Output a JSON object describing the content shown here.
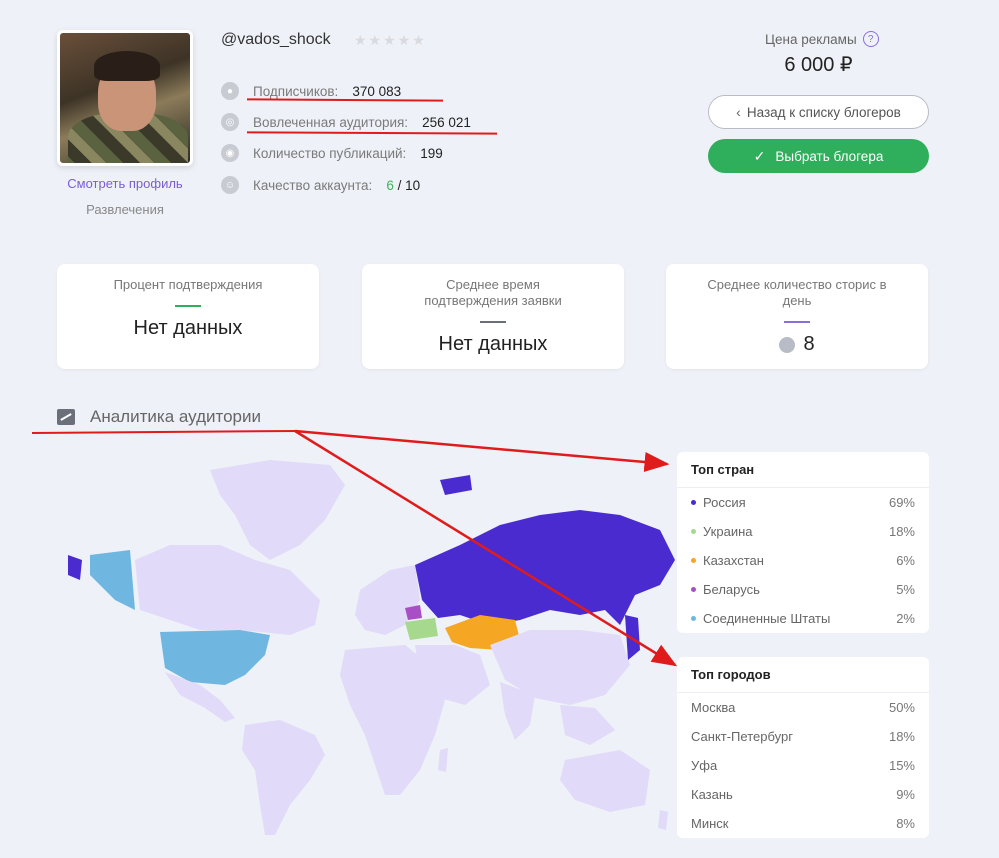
{
  "profile": {
    "username": "@vados_shock",
    "stars": "★★★★★",
    "view_profile": "Смотреть профиль",
    "category": "Развлечения",
    "stats": {
      "subscribers_label": "Подписчиков:",
      "subscribers_value": "370 083",
      "engaged_label": "Вовлеченная аудитория:",
      "engaged_value": "256 021",
      "posts_label": "Количество публикаций:",
      "posts_value": "199",
      "quality_label": "Качество аккаунта:",
      "quality_score": "6",
      "quality_max": "/ 10"
    }
  },
  "pricing": {
    "label": "Цена рекламы",
    "help": "?",
    "value": "6 000 ₽"
  },
  "buttons": {
    "back": "Назад к списку блогеров",
    "select": "Выбрать блогера"
  },
  "cards": [
    {
      "title": "Процент подтверждения",
      "value": "Нет данных",
      "accent": "#2fae5c"
    },
    {
      "title": "Среднее время подтверждения заявки",
      "value": "Нет данных",
      "accent": "#6b6f7a"
    },
    {
      "title": "Среднее количество сторис в день",
      "value": "8",
      "accent": "#8a6fd8"
    }
  ],
  "analytics": {
    "title": "Аналитика аудитории"
  },
  "top_countries": {
    "title": "Топ стран",
    "items": [
      {
        "name": "Россия",
        "pct": "69%",
        "color": "#4a2bd0"
      },
      {
        "name": "Украина",
        "pct": "18%",
        "color": "#a6d88e"
      },
      {
        "name": "Казахстан",
        "pct": "6%",
        "color": "#f5a623"
      },
      {
        "name": "Беларусь",
        "pct": "5%",
        "color": "#a94fc6"
      },
      {
        "name": "Соединенные Штаты",
        "pct": "2%",
        "color": "#6fb7e0"
      }
    ]
  },
  "top_cities": {
    "title": "Топ городов",
    "items": [
      {
        "name": "Москва",
        "pct": "50%"
      },
      {
        "name": "Санкт-Петербург",
        "pct": "18%"
      },
      {
        "name": "Уфа",
        "pct": "15%"
      },
      {
        "name": "Казань",
        "pct": "9%"
      },
      {
        "name": "Минск",
        "pct": "8%"
      }
    ]
  },
  "colors": {
    "map_land": "#e1daf8",
    "annotation": "#e01b1b",
    "primary_green": "#2fae5c",
    "accent_purple": "#7c5cd6"
  }
}
